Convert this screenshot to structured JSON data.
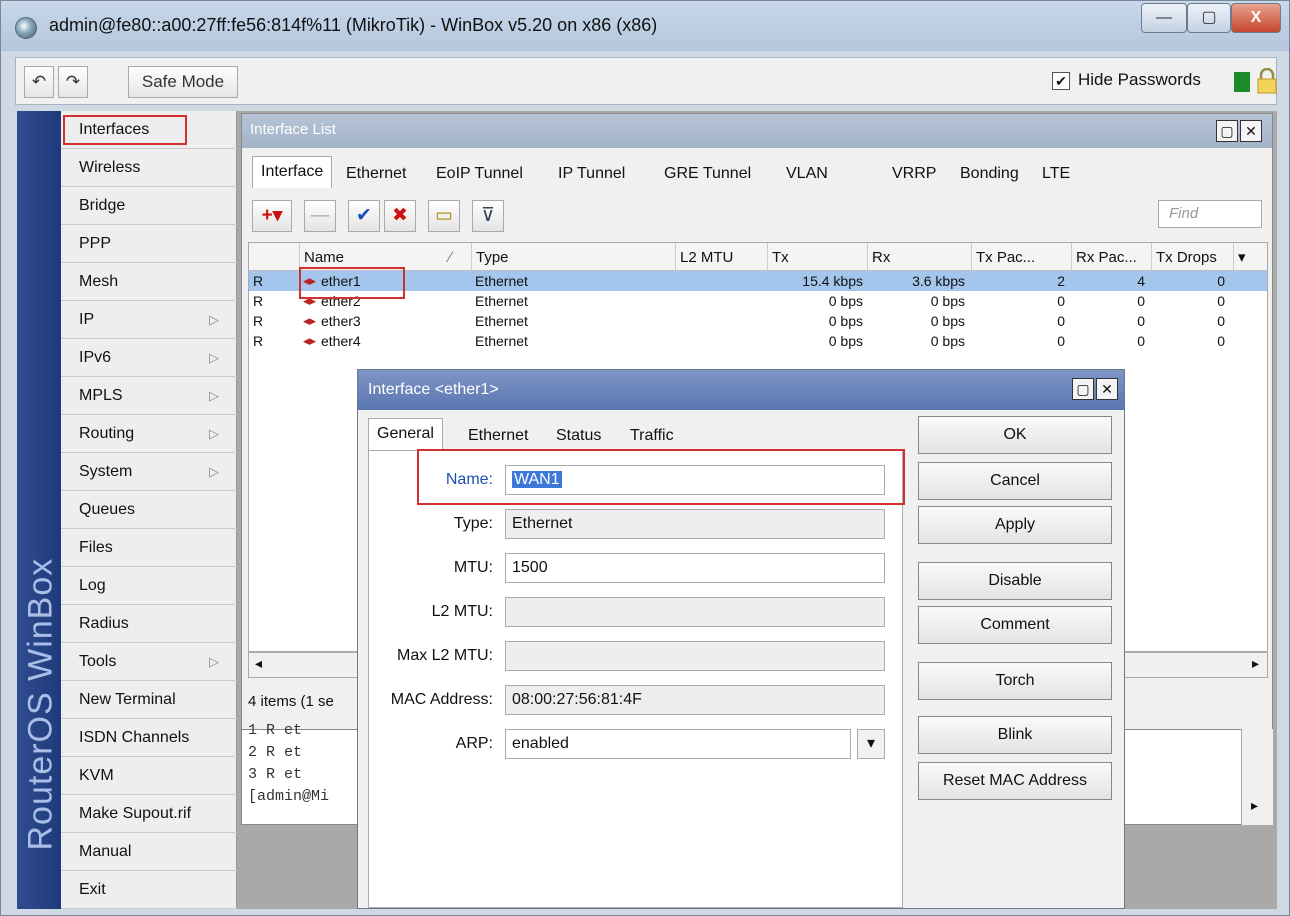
{
  "window": {
    "title": "admin@fe80::a00:27ff:fe56:814f%11 (MikroTik) - WinBox v5.20 on x86 (x86)",
    "controls": {
      "minimize": "—",
      "maximize": "▢",
      "close": "X"
    }
  },
  "toolbar": {
    "undo_label": "↶",
    "redo_label": "↷",
    "safe_mode_label": "Safe Mode",
    "hide_passwords_label": "Hide Passwords",
    "hide_passwords_checked": true,
    "check_mark": "✔"
  },
  "brand": "RouterOS WinBox",
  "sidebar": {
    "items": [
      {
        "label": "Interfaces",
        "submenu": false
      },
      {
        "label": "Wireless",
        "submenu": false
      },
      {
        "label": "Bridge",
        "submenu": false
      },
      {
        "label": "PPP",
        "submenu": false
      },
      {
        "label": "Mesh",
        "submenu": false
      },
      {
        "label": "IP",
        "submenu": true
      },
      {
        "label": "IPv6",
        "submenu": true
      },
      {
        "label": "MPLS",
        "submenu": true
      },
      {
        "label": "Routing",
        "submenu": true
      },
      {
        "label": "System",
        "submenu": true
      },
      {
        "label": "Queues",
        "submenu": false
      },
      {
        "label": "Files",
        "submenu": false
      },
      {
        "label": "Log",
        "submenu": false
      },
      {
        "label": "Radius",
        "submenu": false
      },
      {
        "label": "Tools",
        "submenu": true
      },
      {
        "label": "New Terminal",
        "submenu": false
      },
      {
        "label": "ISDN Channels",
        "submenu": false
      },
      {
        "label": "KVM",
        "submenu": false
      },
      {
        "label": "Make Supout.rif",
        "submenu": false
      },
      {
        "label": "Manual",
        "submenu": false
      },
      {
        "label": "Exit",
        "submenu": false
      }
    ],
    "submenu_arrow": "▷"
  },
  "interface_list": {
    "title": "Interface List",
    "tabs": [
      "Interface",
      "Ethernet",
      "EoIP Tunnel",
      "IP Tunnel",
      "GRE Tunnel",
      "VLAN",
      "VRRP",
      "Bonding",
      "LTE"
    ],
    "active_tab": 0,
    "tools": {
      "add": "+▾",
      "remove": "—",
      "enable": "✔",
      "disable": "✖",
      "comment": "▭",
      "filter": "⊽"
    },
    "find_placeholder": "Find",
    "columns": [
      "Name",
      "Type",
      "L2 MTU",
      "Tx",
      "Rx",
      "Tx Pac...",
      "Rx Pac...",
      "Tx Drops"
    ],
    "sort_indicator": "∕",
    "menu_indicator": "▾",
    "rows": [
      {
        "flag": "R",
        "name": "ether1",
        "type": "Ethernet",
        "l2mtu": "",
        "tx": "15.4 kbps",
        "rx": "3.6 kbps",
        "txp": "2",
        "rxp": "4",
        "txd": "0",
        "selected": true
      },
      {
        "flag": "R",
        "name": "ether2",
        "type": "Ethernet",
        "l2mtu": "",
        "tx": "0 bps",
        "rx": "0 bps",
        "txp": "0",
        "rxp": "0",
        "txd": "0",
        "selected": false
      },
      {
        "flag": "R",
        "name": "ether3",
        "type": "Ethernet",
        "l2mtu": "",
        "tx": "0 bps",
        "rx": "0 bps",
        "txp": "0",
        "rxp": "0",
        "txd": "0",
        "selected": false
      },
      {
        "flag": "R",
        "name": "ether4",
        "type": "Ethernet",
        "l2mtu": "",
        "tx": "0 bps",
        "rx": "0 bps",
        "txp": "0",
        "rxp": "0",
        "txd": "0",
        "selected": false
      }
    ],
    "status_text": "4 items (1 se",
    "scroll_left": "◂",
    "scroll_right": "▸"
  },
  "terminal": {
    "lines": [
      "1  R  et",
      "2  R  et",
      "3  R  et",
      "[admin@Mi"
    ]
  },
  "dialog": {
    "title": "Interface <ether1>",
    "tabs": [
      "General",
      "Ethernet",
      "Status",
      "Traffic"
    ],
    "active_tab": 0,
    "fields": {
      "name_label": "Name:",
      "name_value": "WAN1",
      "type_label": "Type:",
      "type_value": "Ethernet",
      "mtu_label": "MTU:",
      "mtu_value": "1500",
      "l2mtu_label": "L2 MTU:",
      "l2mtu_value": "",
      "maxl2mtu_label": "Max L2 MTU:",
      "maxl2mtu_value": "",
      "mac_label": "MAC Address:",
      "mac_value": "08:00:27:56:81:4F",
      "arp_label": "ARP:",
      "arp_value": "enabled"
    },
    "buttons": [
      "OK",
      "Cancel",
      "Apply",
      "Disable",
      "Comment",
      "Torch",
      "Blink",
      "Reset MAC Address"
    ],
    "dropdown_arrow": "▾"
  }
}
